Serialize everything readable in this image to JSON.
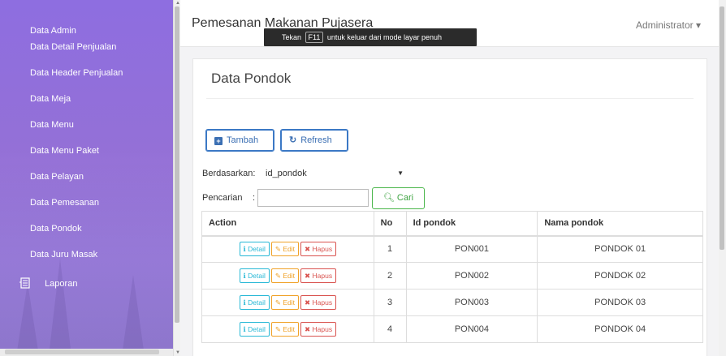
{
  "sidebar": {
    "items": [
      {
        "label": "Data Admin"
      },
      {
        "label": "Data Detail Penjualan"
      },
      {
        "label": "Data Header Penjualan"
      },
      {
        "label": "Data Meja"
      },
      {
        "label": "Data Menu"
      },
      {
        "label": "Data Menu Paket"
      },
      {
        "label": "Data Pelayan"
      },
      {
        "label": "Data Pemesanan"
      },
      {
        "label": "Data Pondok"
      },
      {
        "label": "Data Juru Masak"
      },
      {
        "label": "Laporan",
        "icon": "report-icon"
      }
    ]
  },
  "header": {
    "title": "Pemesanan Makanan Pujasera",
    "user_menu": "Administrator",
    "fullscreen_notice": {
      "prefix": "Tekan",
      "key": "F11",
      "suffix": "untuk keluar dari mode layar penuh"
    }
  },
  "panel": {
    "title": "Data Pondok",
    "tambah_label": "Tambah",
    "refresh_label": "Refresh",
    "filter_label": "Berdasarkan:",
    "filter_value": "id_pondok",
    "search_label": "Pencarian",
    "search_sep": ":",
    "search_value": "",
    "cari_label": "Cari"
  },
  "table": {
    "headers": [
      "Action",
      "No",
      "Id pondok",
      "Nama pondok"
    ],
    "actions": {
      "detail": "Detail",
      "edit": "Edit",
      "hapus": "Hapus"
    },
    "rows": [
      {
        "no": "1",
        "id": "PON001",
        "nama": "PONDOK 01"
      },
      {
        "no": "2",
        "id": "PON002",
        "nama": "PONDOK 02"
      },
      {
        "no": "3",
        "id": "PON003",
        "nama": "PONDOK 03"
      },
      {
        "no": "4",
        "id": "PON004",
        "nama": "PONDOK 04"
      }
    ]
  },
  "colors": {
    "sidebar": "#8e6ee0",
    "primary": "#3b78c5",
    "success": "#49b64a",
    "info": "#28b8d6",
    "warning": "#f0a228",
    "danger": "#d9534f"
  }
}
